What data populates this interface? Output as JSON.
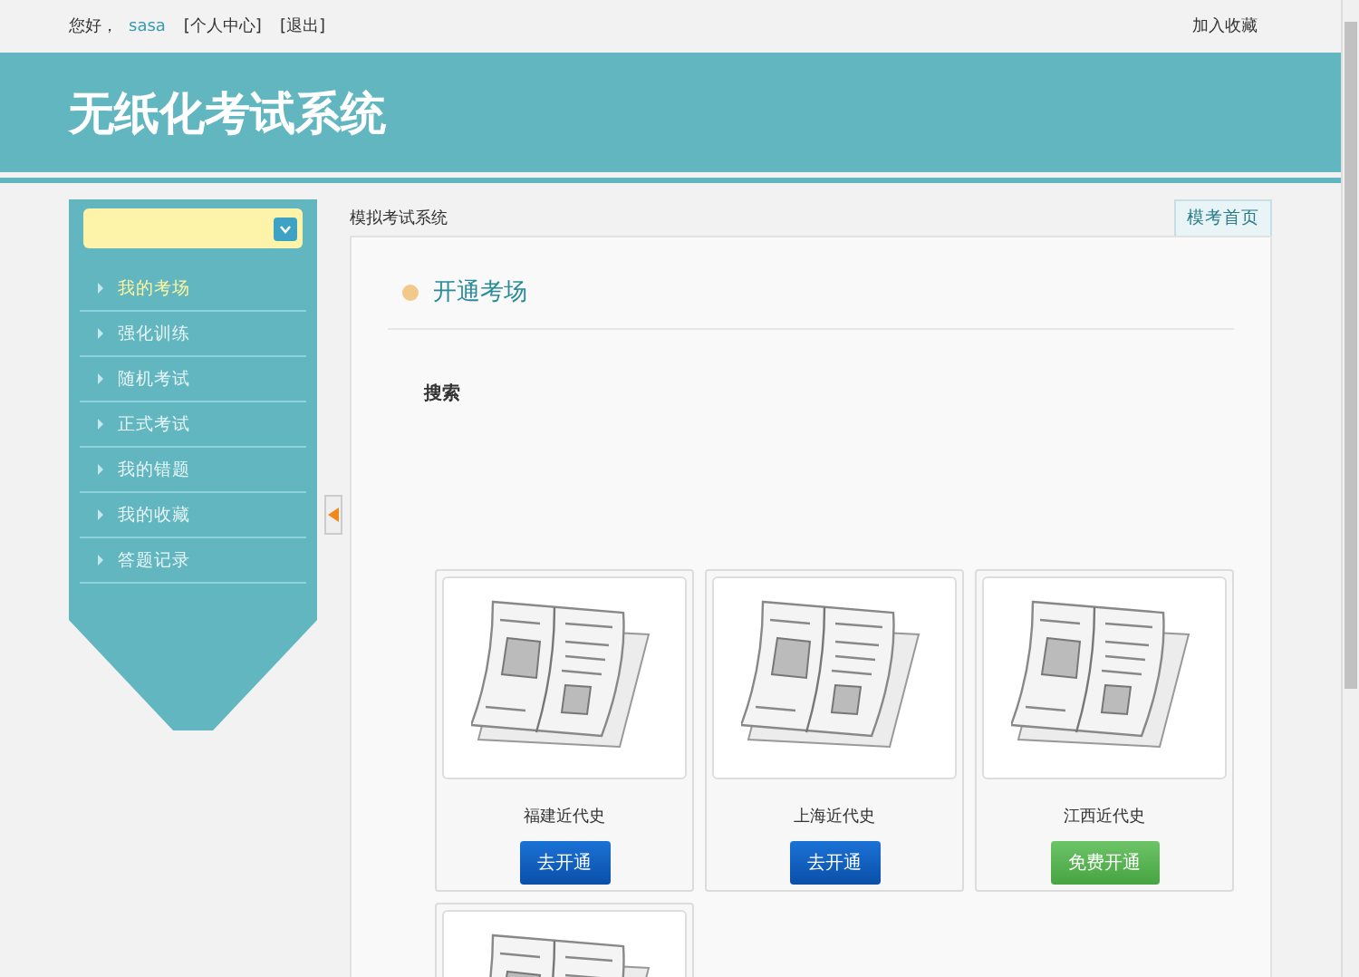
{
  "top_bar": {
    "greeting": "您好，",
    "username": "sasa",
    "links": [
      "[个人中心]",
      "[退出]"
    ],
    "bookmark": "加入收藏"
  },
  "banner": {
    "title": "无纸化考试系统"
  },
  "sidebar": {
    "items": [
      {
        "label": "我的考场",
        "selected": true
      },
      {
        "label": "强化训练",
        "selected": false
      },
      {
        "label": "随机考试",
        "selected": false
      },
      {
        "label": "正式考试",
        "selected": false
      },
      {
        "label": "我的错题",
        "selected": false
      },
      {
        "label": "我的收藏",
        "selected": false
      },
      {
        "label": "答题记录",
        "selected": false
      }
    ]
  },
  "breadcrumb": "模拟考试系统",
  "home_button": "模考首页",
  "section_title": "开通考场",
  "search_label": "搜索",
  "cards": [
    {
      "kind": "full",
      "title": "福建近代史",
      "button": {
        "label": "去开通",
        "kind": "paid"
      }
    },
    {
      "kind": "full",
      "title": "上海近代史",
      "button": {
        "label": "去开通",
        "kind": "paid"
      }
    },
    {
      "kind": "full",
      "title": "江西近代史",
      "button": {
        "label": "免费开通",
        "kind": "free"
      }
    },
    {
      "kind": "cut_off"
    }
  ]
}
